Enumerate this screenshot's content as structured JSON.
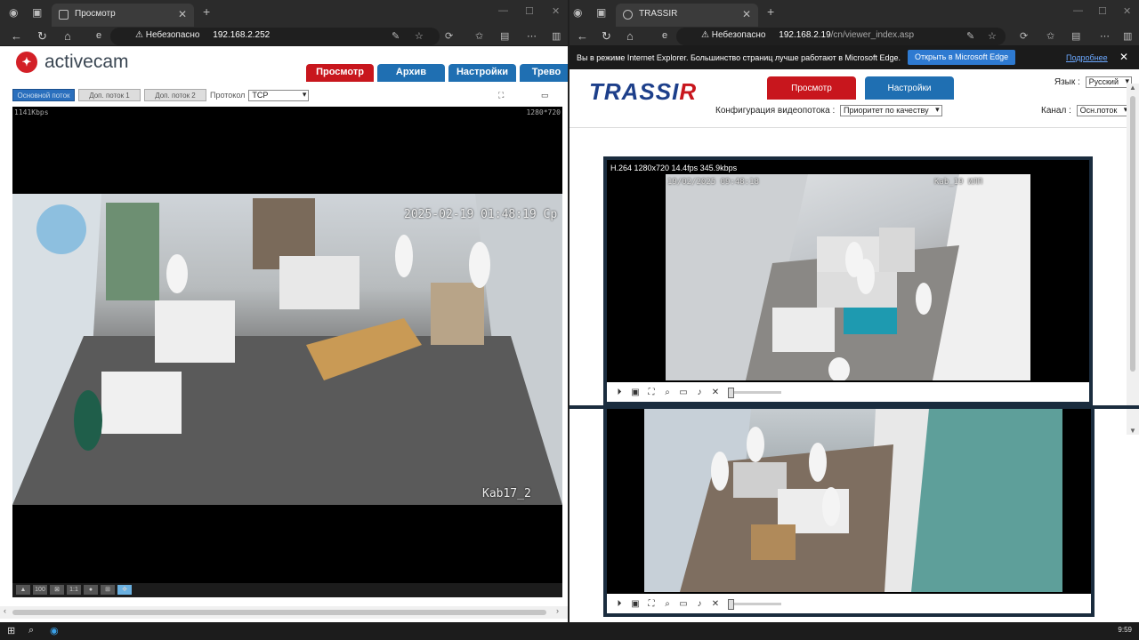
{
  "left": {
    "tab_title": "Просмотр",
    "security": "Небезопасно",
    "url": "192.168.2.252",
    "brand": "activecam",
    "nav": [
      {
        "label": "Просмотр",
        "color": "#c8161d"
      },
      {
        "label": "Архив",
        "color": "#1f6fb2"
      },
      {
        "label": "Настройки",
        "color": "#1f6fb2"
      },
      {
        "label": "Трево",
        "color": "#1f6fb2"
      }
    ],
    "streams": [
      "Основной поток",
      "Доп. поток 1",
      "Доп. поток 2"
    ],
    "protocol_label": "Протокол",
    "protocol_value": "TCP",
    "bitrate": "1141Kbps",
    "resolution": "1280*720",
    "timestamp": "2025-02-19 01:48:19 Ср",
    "camera_name": "Kab17_2",
    "controls": [
      "snapshot",
      "100%",
      "fit",
      "1:1",
      "record",
      "grid",
      "ptz"
    ]
  },
  "right": {
    "tab_title": "TRASSIR",
    "security": "Небезопасно",
    "url_host": "192.168.2.19",
    "url_path": "/cn/viewer_index.asp",
    "ie_msg": "Вы в режиме Internet Explorer. Большинство страниц лучше работают в Microsoft Edge.",
    "ie_btn": "Открыть в Microsoft Edge",
    "ie_more": "Подробнее",
    "brand": "TRASSIR",
    "tabs": [
      {
        "label": "Просмотр",
        "color": "#c8161d"
      },
      {
        "label": "Настройки",
        "color": "#1f6fb2"
      }
    ],
    "lang_label": "Язык :",
    "lang_value": "Русский",
    "cfg_label": "Конфигурация видеопотока :",
    "cfg_value": "Приоритет по качеству",
    "channel_label": "Канал :",
    "channel_value": "Осн.поток",
    "stream_info": "H.264 1280x720 14.4fps 345.9kbps",
    "cam1_ts": "19/02/2025 09:48:18",
    "cam1_name": "Kab_19 ИЛП"
  },
  "taskbar": {
    "clock": "9:59"
  }
}
